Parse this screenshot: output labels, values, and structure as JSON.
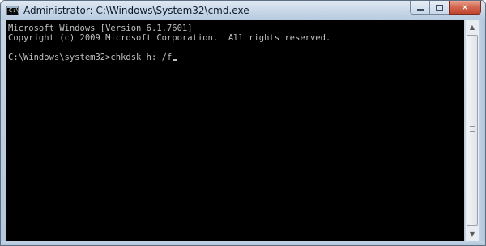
{
  "window": {
    "title": "Administrator: C:\\Windows\\System32\\cmd.exe",
    "icon": "cmd-app-icon",
    "buttons": {
      "minimize": "minimize-icon",
      "maximize": "maximize-icon",
      "close": "close-icon"
    }
  },
  "console": {
    "lines": [
      "Microsoft Windows [Version 6.1.7601]",
      "Copyright (c) 2009 Microsoft Corporation.  All rights reserved.",
      "",
      "C:\\Windows\\system32>chkdsk h: /f"
    ],
    "background": "#000000",
    "foreground": "#c0c0c0"
  },
  "scrollbar": {
    "up_arrow": "▲",
    "down_arrow": "▼"
  },
  "colors": {
    "frame": "#b9cbe0",
    "close_button": "#c0432d"
  }
}
